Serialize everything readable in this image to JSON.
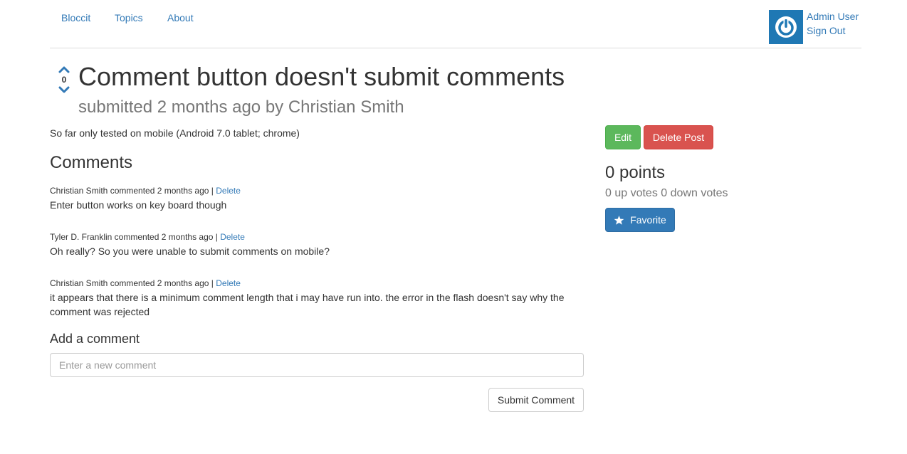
{
  "nav": {
    "links": [
      "Bloccit",
      "Topics",
      "About"
    ],
    "user_name": "Admin User",
    "sign_out": "Sign Out"
  },
  "post": {
    "vote_count": "0",
    "title": "Comment button doesn't submit comments",
    "subtitle": "submitted 2 months ago by Christian Smith",
    "body": "So far only tested on mobile (Android 7.0 tablet; chrome)"
  },
  "comments": {
    "heading": "Comments",
    "items": [
      {
        "meta": "Christian Smith commented 2 months ago | ",
        "delete": "Delete",
        "body": "Enter button works on key board though"
      },
      {
        "meta": "Tyler D. Franklin commented 2 months ago | ",
        "delete": "Delete",
        "body": "Oh really? So you were unable to submit comments on mobile?"
      },
      {
        "meta": "Christian Smith commented 2 months ago | ",
        "delete": "Delete",
        "body": "it appears that there is a minimum comment length that i may have run into. the error in the flash doesn't say why the comment was rejected"
      }
    ],
    "add_heading": "Add a comment",
    "input_placeholder": "Enter a new comment",
    "submit_label": "Submit Comment"
  },
  "sidebar": {
    "edit_label": "Edit",
    "delete_label": "Delete Post",
    "points": "0 points",
    "votes": "0 up votes 0 down votes",
    "favorite_label": "Favorite"
  },
  "colors": {
    "link": "#337ab7",
    "success": "#5cb85c",
    "danger": "#d9534f",
    "primary": "#337ab7",
    "avatar": "#1f78b4"
  }
}
